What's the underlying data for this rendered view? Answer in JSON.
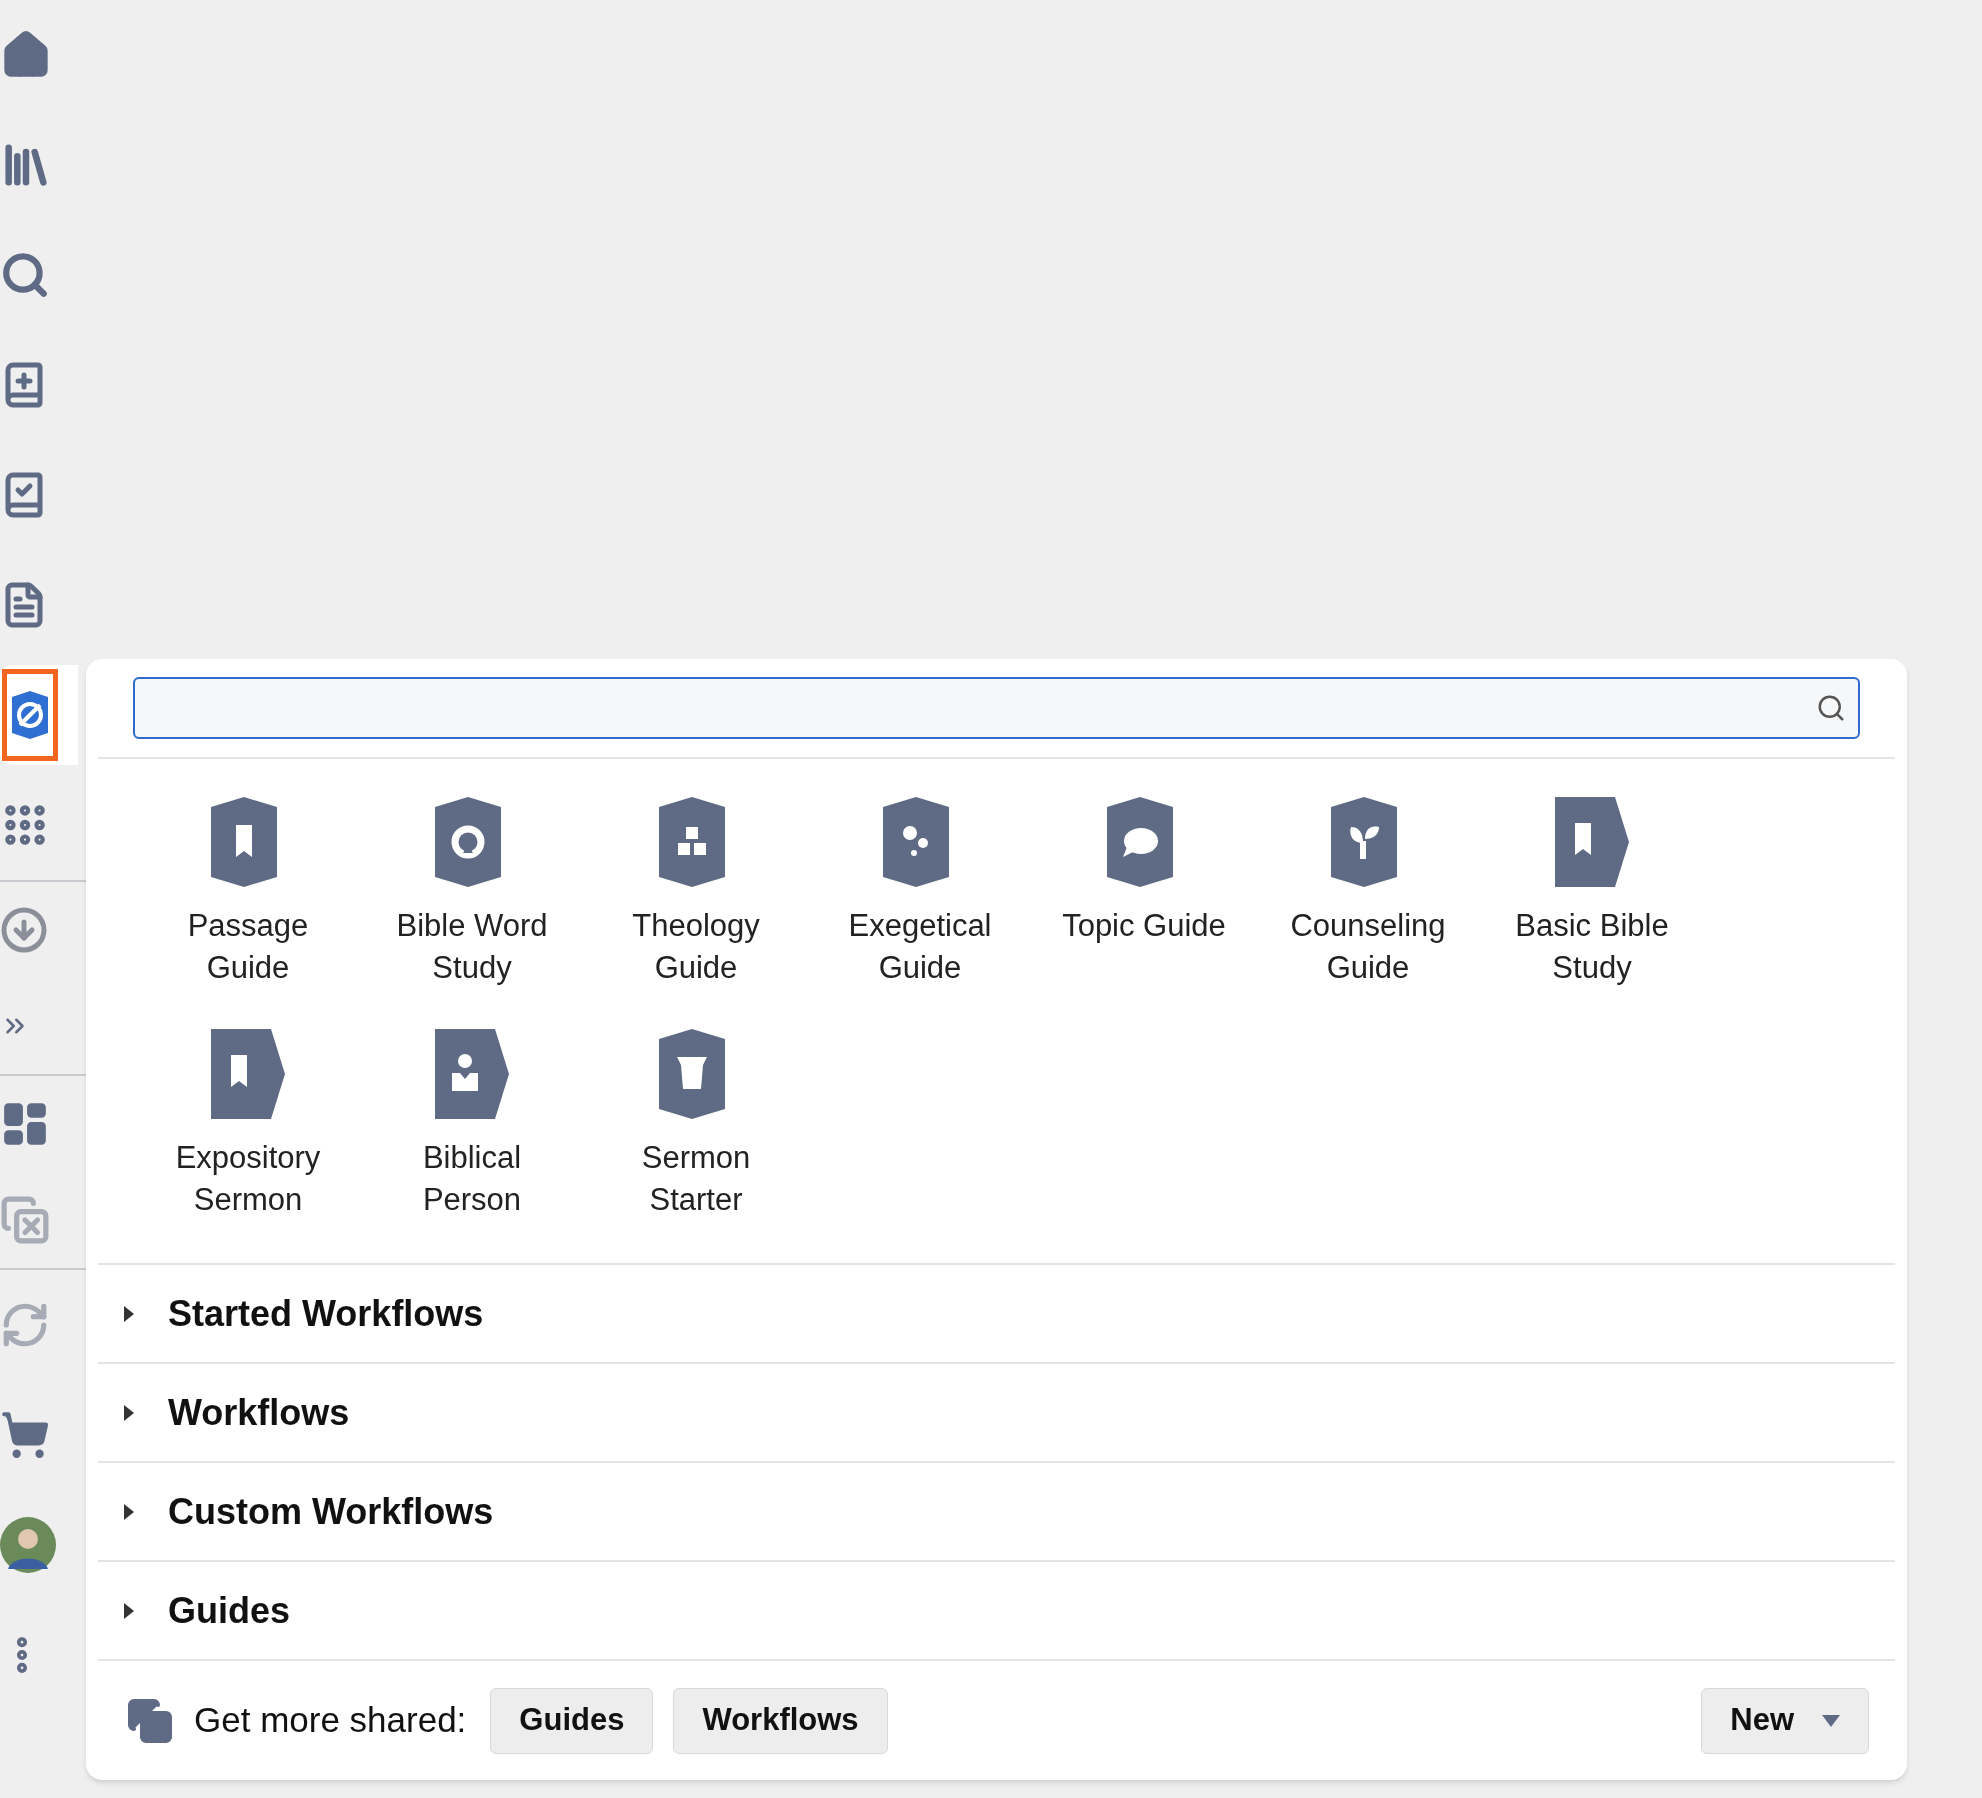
{
  "sidebar": {
    "groups": [
      {
        "items": [
          {
            "selected": false
          },
          {
            "selected": false
          },
          {
            "selected": false
          },
          {
            "selected": false
          },
          {
            "selected": false
          },
          {
            "selected": false
          },
          {
            "selected": true
          },
          {
            "selected": false
          }
        ]
      },
      {
        "items": [
          {
            "selected": false
          },
          {
            "selected": false
          }
        ]
      },
      {
        "items": [
          {
            "selected": false
          },
          {
            "selected": false
          }
        ]
      },
      {
        "items": [
          {
            "selected": false
          },
          {
            "selected": false
          },
          {
            "selected": false
          },
          {
            "selected": false
          }
        ]
      }
    ]
  },
  "search": {
    "focused": true
  },
  "tiles": [
    {
      "label": "Passage Guide",
      "kind": "guide"
    },
    {
      "label": "Bible Word Study",
      "kind": "guide"
    },
    {
      "label": "Theology Guide",
      "kind": "guide"
    },
    {
      "label": "Exegetical Guide",
      "kind": "guide"
    },
    {
      "label": "Topic Guide",
      "kind": "guide"
    },
    {
      "label": "Counseling Guide",
      "kind": "guide"
    },
    {
      "label": "Basic Bible Study",
      "kind": "workflow"
    },
    {
      "label": "Expository Sermon",
      "kind": "workflow"
    },
    {
      "label": "Biblical Person",
      "kind": "workflow"
    },
    {
      "label": "Sermon Starter",
      "kind": "guide"
    }
  ],
  "sections": [
    {
      "label": "Started Workflows",
      "expanded": false
    },
    {
      "label": "Workflows",
      "expanded": false
    },
    {
      "label": "Custom Workflows",
      "expanded": false
    },
    {
      "label": "Guides",
      "expanded": false
    }
  ],
  "footer": {
    "label": "Get more shared:",
    "buttons": [
      "Guides",
      "Workflows"
    ],
    "new_button": "New"
  }
}
